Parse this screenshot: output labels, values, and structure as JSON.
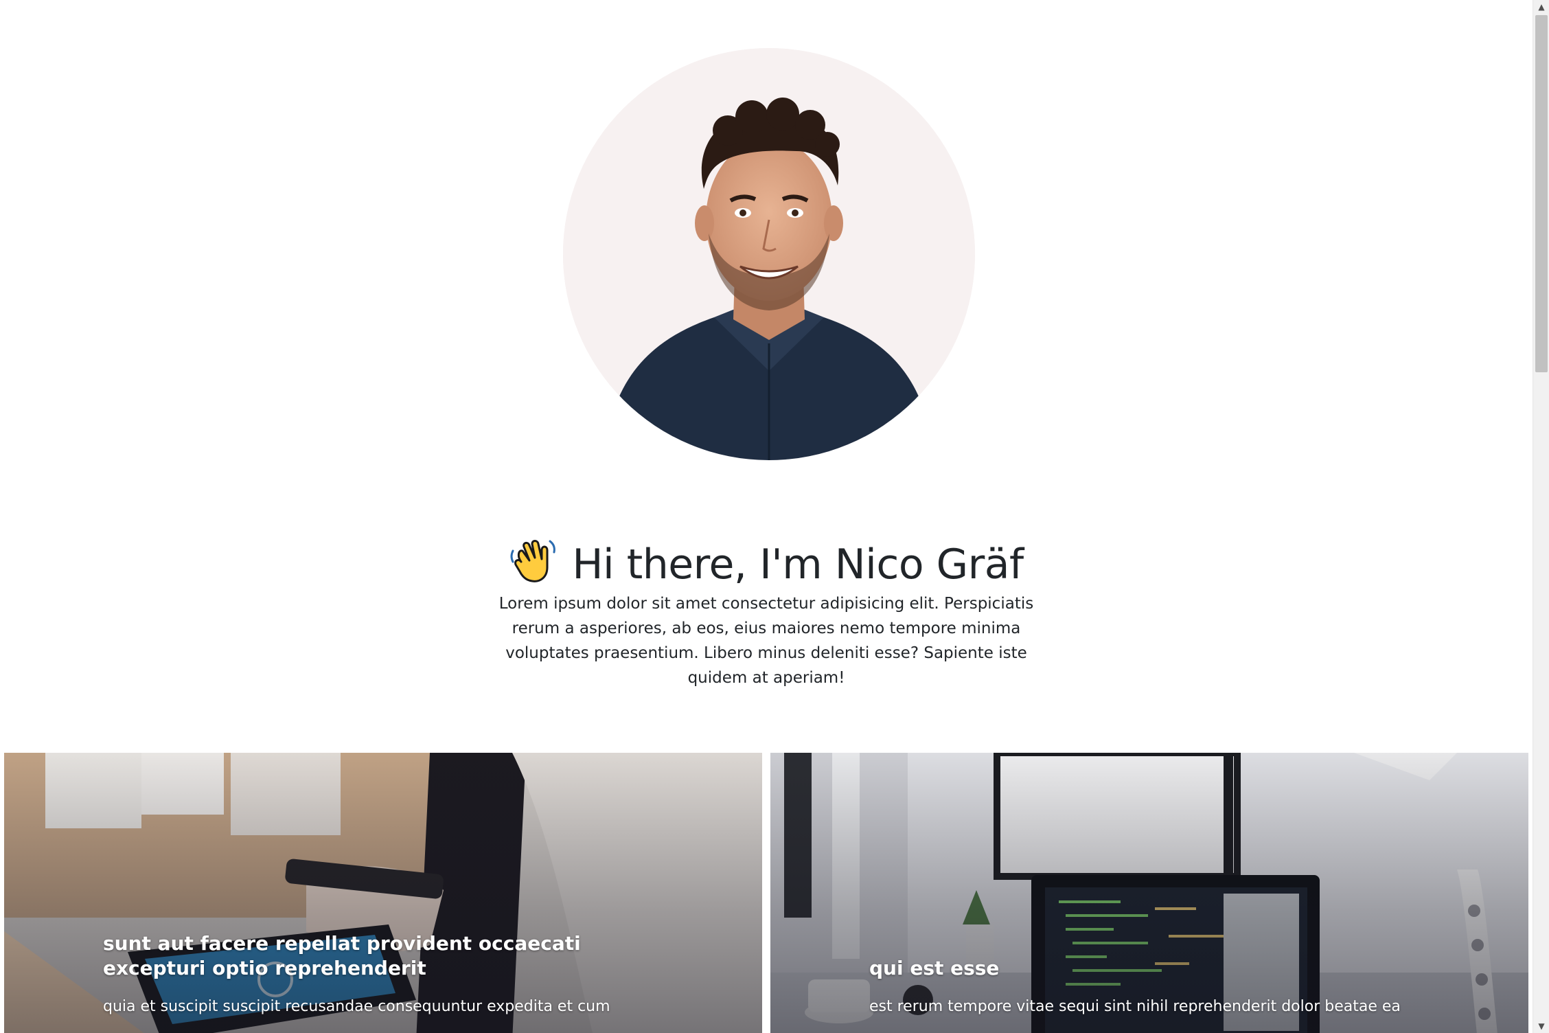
{
  "hero": {
    "avatar_alt": "Portrait photo",
    "wave_icon": "waving-hand-icon",
    "greeting": "Hi there, I'm Nico Gräf",
    "intro": "Lorem ipsum dolor sit amet consectetur adipisicing elit. Perspiciatis rerum a asperiores, ab eos, eius maiores nemo tempore minima voluptates praesentium. Libero minus deleniti esse? Sapiente iste quidem at aperiam!"
  },
  "posts": [
    {
      "title": "sunt aut facere repellat provident occaecati excepturi optio reprehenderit",
      "body": "quia et suscipit suscipit recusandae consequuntur expedita et cum"
    },
    {
      "title": "qui est esse",
      "body": "est rerum tempore vitae sequi sint nihil reprehenderit dolor beatae ea"
    }
  ],
  "colors": {
    "text": "#212529",
    "background": "#ffffff",
    "scrollbar_thumb": "#c1c1c1"
  }
}
